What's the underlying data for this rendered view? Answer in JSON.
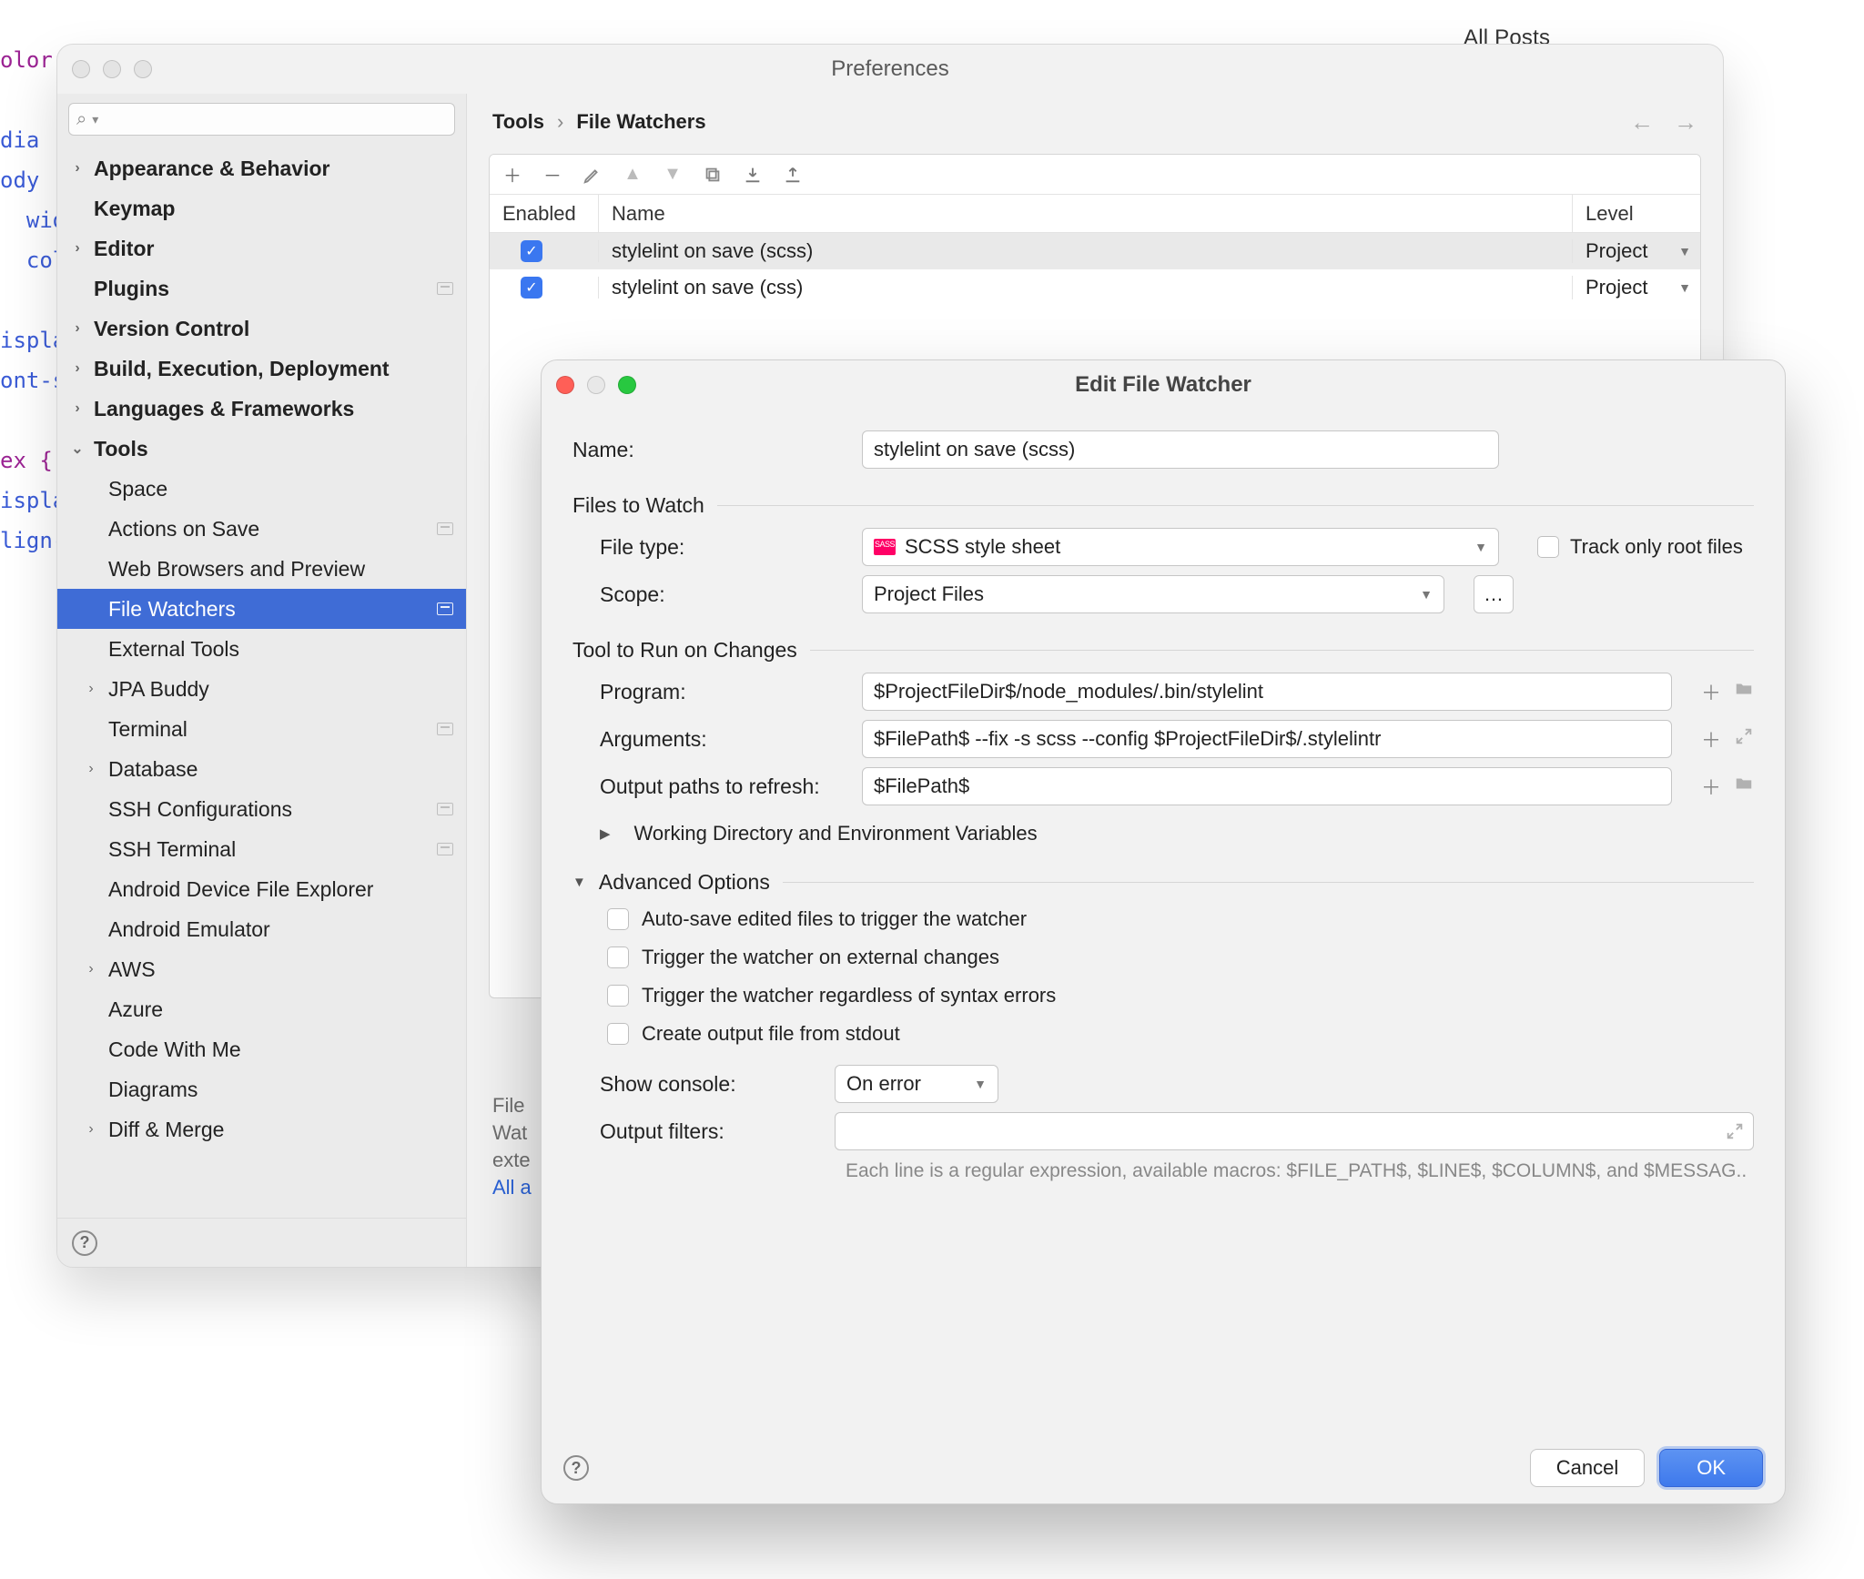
{
  "background": {
    "all_posts": "All Posts",
    "code_fragments": [
      "olor",
      "dia",
      "ody",
      "wid",
      "col",
      "ispla",
      "ont-s",
      "ex {",
      "ispla",
      "lign-"
    ]
  },
  "prefs": {
    "title": "Preferences",
    "breadcrumb": {
      "root": "Tools",
      "sep": "›",
      "current": "File Watchers"
    },
    "sidebar": {
      "search_placeholder": "",
      "items": [
        {
          "label": "Appearance & Behavior",
          "bold": true,
          "arrow": ">"
        },
        {
          "label": "Keymap",
          "bold": true
        },
        {
          "label": "Editor",
          "bold": true,
          "arrow": ">"
        },
        {
          "label": "Plugins",
          "bold": true,
          "pin": true
        },
        {
          "label": "Version Control",
          "bold": true,
          "arrow": ">"
        },
        {
          "label": "Build, Execution, Deployment",
          "bold": true,
          "arrow": ">"
        },
        {
          "label": "Languages & Frameworks",
          "bold": true,
          "arrow": ">"
        },
        {
          "label": "Tools",
          "bold": true,
          "arrow": "v"
        },
        {
          "label": "Space",
          "depth": 1
        },
        {
          "label": "Actions on Save",
          "depth": 1,
          "pin": true
        },
        {
          "label": "Web Browsers and Preview",
          "depth": 1
        },
        {
          "label": "File Watchers",
          "depth": 1,
          "selected": true,
          "pin": true
        },
        {
          "label": "External Tools",
          "depth": 1
        },
        {
          "label": "JPA Buddy",
          "depth": 1,
          "arrow": ">"
        },
        {
          "label": "Terminal",
          "depth": 1,
          "pin": true
        },
        {
          "label": "Database",
          "depth": 1,
          "arrow": ">"
        },
        {
          "label": "SSH Configurations",
          "depth": 1,
          "pin": true
        },
        {
          "label": "SSH Terminal",
          "depth": 1,
          "pin": true
        },
        {
          "label": "Android Device File Explorer",
          "depth": 1
        },
        {
          "label": "Android Emulator",
          "depth": 1
        },
        {
          "label": "AWS",
          "depth": 1,
          "arrow": ">"
        },
        {
          "label": "Azure",
          "depth": 1
        },
        {
          "label": "Code With Me",
          "depth": 1
        },
        {
          "label": "Diagrams",
          "depth": 1
        },
        {
          "label": "Diff & Merge",
          "depth": 1,
          "arrow": ">"
        }
      ]
    },
    "table": {
      "cols": {
        "enabled": "Enabled",
        "name": "Name",
        "level": "Level"
      },
      "rows": [
        {
          "enabled": true,
          "name": "stylelint on save (scss)",
          "level": "Project",
          "selected": true
        },
        {
          "enabled": true,
          "name": "stylelint on save (css)",
          "level": "Project"
        }
      ]
    },
    "hint_lines": [
      "File",
      "Wat",
      "exte"
    ],
    "hint_link": "All a"
  },
  "efw": {
    "title": "Edit File Watcher",
    "labels": {
      "name": "Name:",
      "files_to_watch": "Files to Watch",
      "file_type": "File type:",
      "scope": "Scope:",
      "track_root": "Track only root files",
      "tool_to_run": "Tool to Run on Changes",
      "program": "Program:",
      "arguments": "Arguments:",
      "output_paths": "Output paths to refresh:",
      "working_dir": "Working Directory and Environment Variables",
      "advanced": "Advanced Options",
      "show_console": "Show console:",
      "output_filters": "Output filters:"
    },
    "values": {
      "name": "stylelint on save (scss)",
      "file_type": "SCSS style sheet",
      "scope": "Project Files",
      "program": "$ProjectFileDir$/node_modules/.bin/stylelint",
      "arguments": "$FilePath$ --fix -s scss --config $ProjectFileDir$/.stylelintr",
      "output_paths": "$FilePath$",
      "show_console": "On error",
      "output_filters": ""
    },
    "checks": {
      "auto_save": "Auto-save edited files to trigger the watcher",
      "external": "Trigger the watcher on external changes",
      "syntax": "Trigger the watcher regardless of syntax errors",
      "stdout": "Create output file from stdout"
    },
    "hint": "Each line is a regular expression, available macros: $FILE_PATH$, $LINE$, $COLUMN$, and $MESSAG..",
    "buttons": {
      "cancel": "Cancel",
      "ok": "OK",
      "help": "?"
    }
  }
}
